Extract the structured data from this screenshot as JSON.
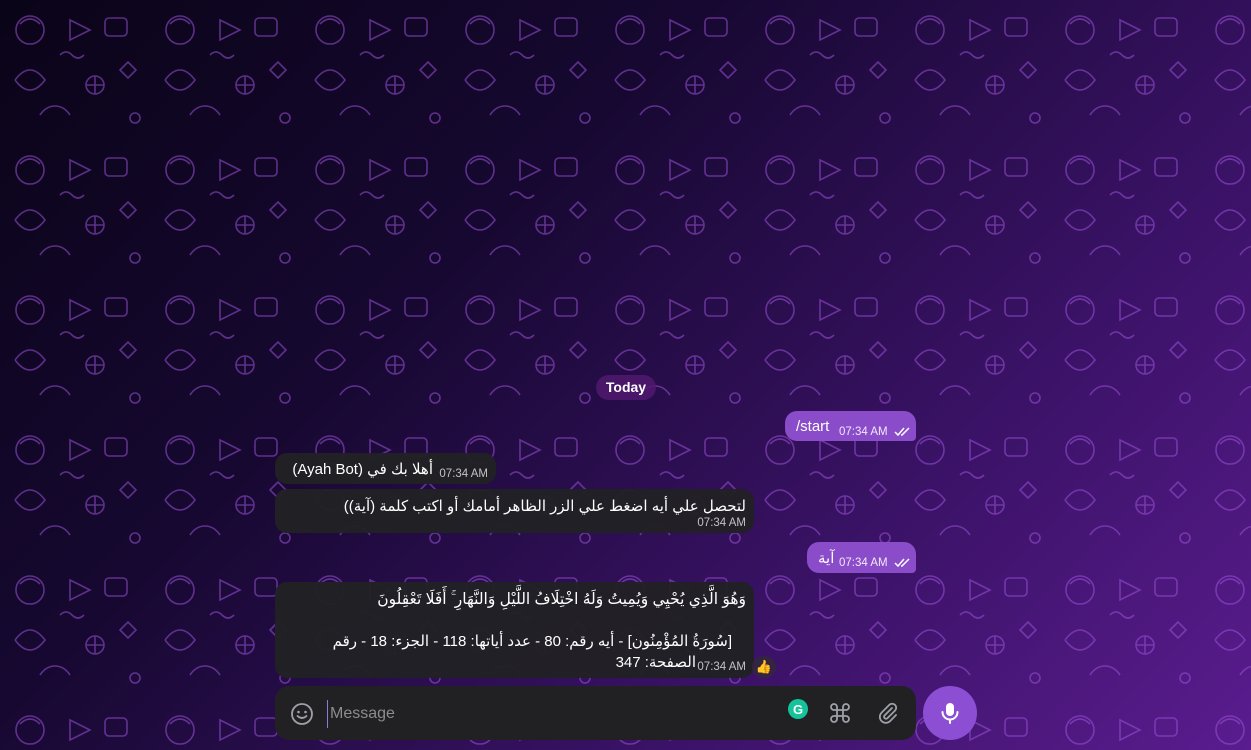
{
  "chat": {
    "date_label": "Today",
    "messages": [
      {
        "text": "/start",
        "time": "07:34 AM"
      },
      {
        "text": "أهلا بك في (Ayah Bot)",
        "time": "07:34 AM"
      },
      {
        "text": "لتحصل علي أيه اضغط علي الزر الظاهر أمامك أو اكتب كلمة (آية))",
        "time": "07:34 AM"
      },
      {
        "text": "آية",
        "time": "07:34 AM"
      },
      {
        "ayah": "وَهُوَ الَّذِي يُحْيِي وَيُمِيتُ وَلَهُ اخْتِلَافُ اللَّيْلِ وَالنَّهَارِ ۚ أَفَلَا تَعْقِلُونَ",
        "info_line1": "[سُورَةُ المُؤْمِنُون] - أيه رقم: 80 - عدد أياتها: 118 - الجزء: 18 - رقم",
        "info_line2": "الصفحة: 347",
        "time": "07:34 AM",
        "reaction": "👍"
      }
    ]
  },
  "composer": {
    "placeholder": "Message",
    "grammarly_letter": "G"
  },
  "colors": {
    "outgoing_bubble": "#8a4cc9",
    "incoming_bubble": "#212124",
    "mic_button": "#8c4fd4"
  },
  "icons": [
    "emoji-icon",
    "command-icon",
    "attach-icon",
    "mic-icon",
    "double-check-icon"
  ]
}
